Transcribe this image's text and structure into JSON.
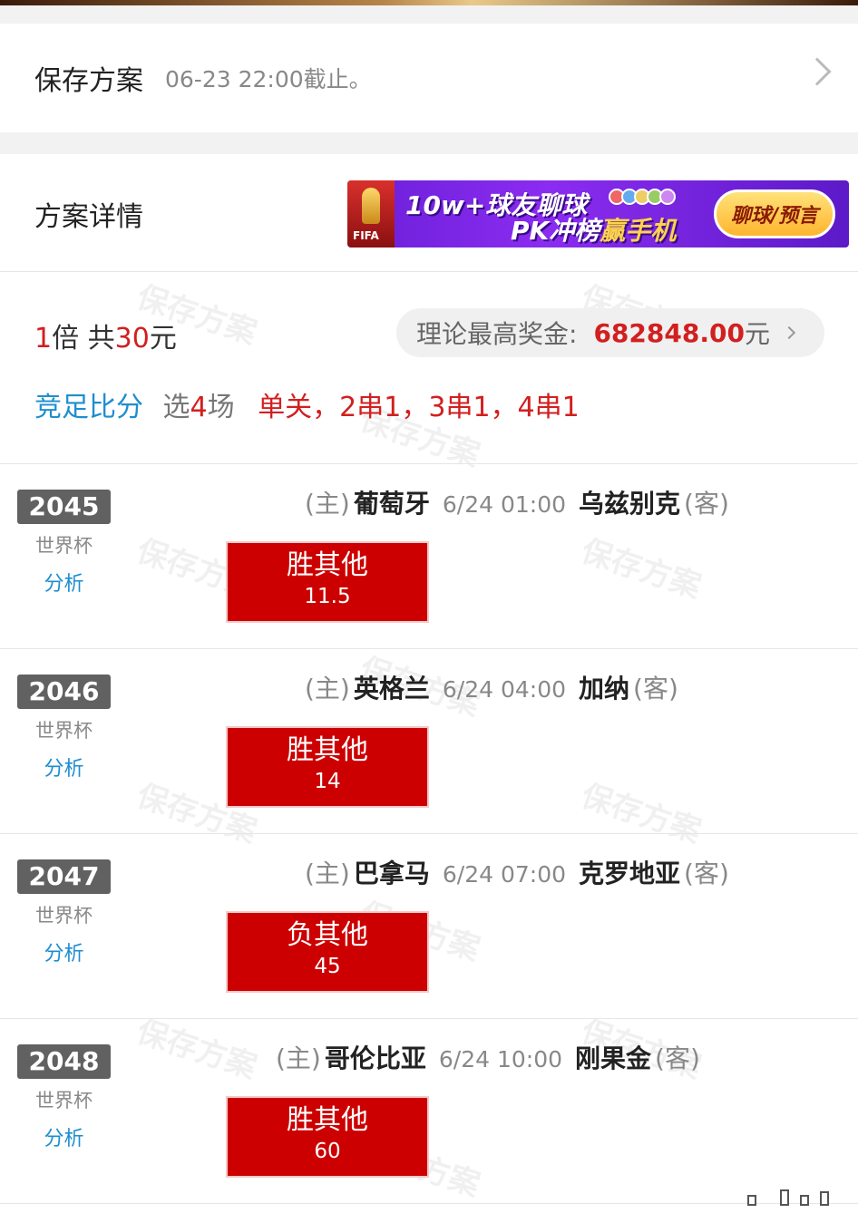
{
  "save": {
    "title": "保存方案",
    "deadline": "06-23 22:00截止。"
  },
  "details": {
    "title": "方案详情"
  },
  "banner": {
    "line1": "10w+球友聊球",
    "line2_a": "PK冲榜",
    "line2_b": "赢手机",
    "button": "聊球/预言",
    "logo_text": "FIFA"
  },
  "watermark": "保存方案",
  "summary": {
    "multiple_num": "1",
    "multiple_unit": "倍 共",
    "total_num": "30",
    "total_unit": "元",
    "prize_label": "理论最高奖金:",
    "prize_value": "682848.00",
    "prize_unit": "元",
    "play_type": "竞足比分",
    "select_prefix": "选",
    "select_count": "4",
    "select_suffix": "场",
    "pass_types": "单关，2串1，3串1，4串1"
  },
  "matches": [
    {
      "no": "2045",
      "league": "世界杯",
      "analysis": "分析",
      "home_tag": "(主)",
      "home": "葡萄牙",
      "time": "6/24 01:00",
      "away": "乌兹别克",
      "away_tag": "(客)",
      "pick": "胜其他",
      "odds": "11.5"
    },
    {
      "no": "2046",
      "league": "世界杯",
      "analysis": "分析",
      "home_tag": "(主)",
      "home": "英格兰",
      "time": "6/24 04:00",
      "away": "加纳",
      "away_tag": "(客)",
      "pick": "胜其他",
      "odds": "14"
    },
    {
      "no": "2047",
      "league": "世界杯",
      "analysis": "分析",
      "home_tag": "(主)",
      "home": "巴拿马",
      "time": "6/24 07:00",
      "away": "克罗地亚",
      "away_tag": "(客)",
      "pick": "负其他",
      "odds": "45"
    },
    {
      "no": "2048",
      "league": "世界杯",
      "analysis": "分析",
      "home_tag": "(主)",
      "home": "哥伦比亚",
      "time": "6/24 10:00",
      "away": "刚果金",
      "away_tag": "(客)",
      "pick": "胜其他",
      "odds": "60"
    }
  ],
  "colors": {
    "accent_red": "#d21f1f",
    "pick_red": "#cc0000",
    "link_blue": "#1e8ecf",
    "badge_gray": "#616161"
  }
}
